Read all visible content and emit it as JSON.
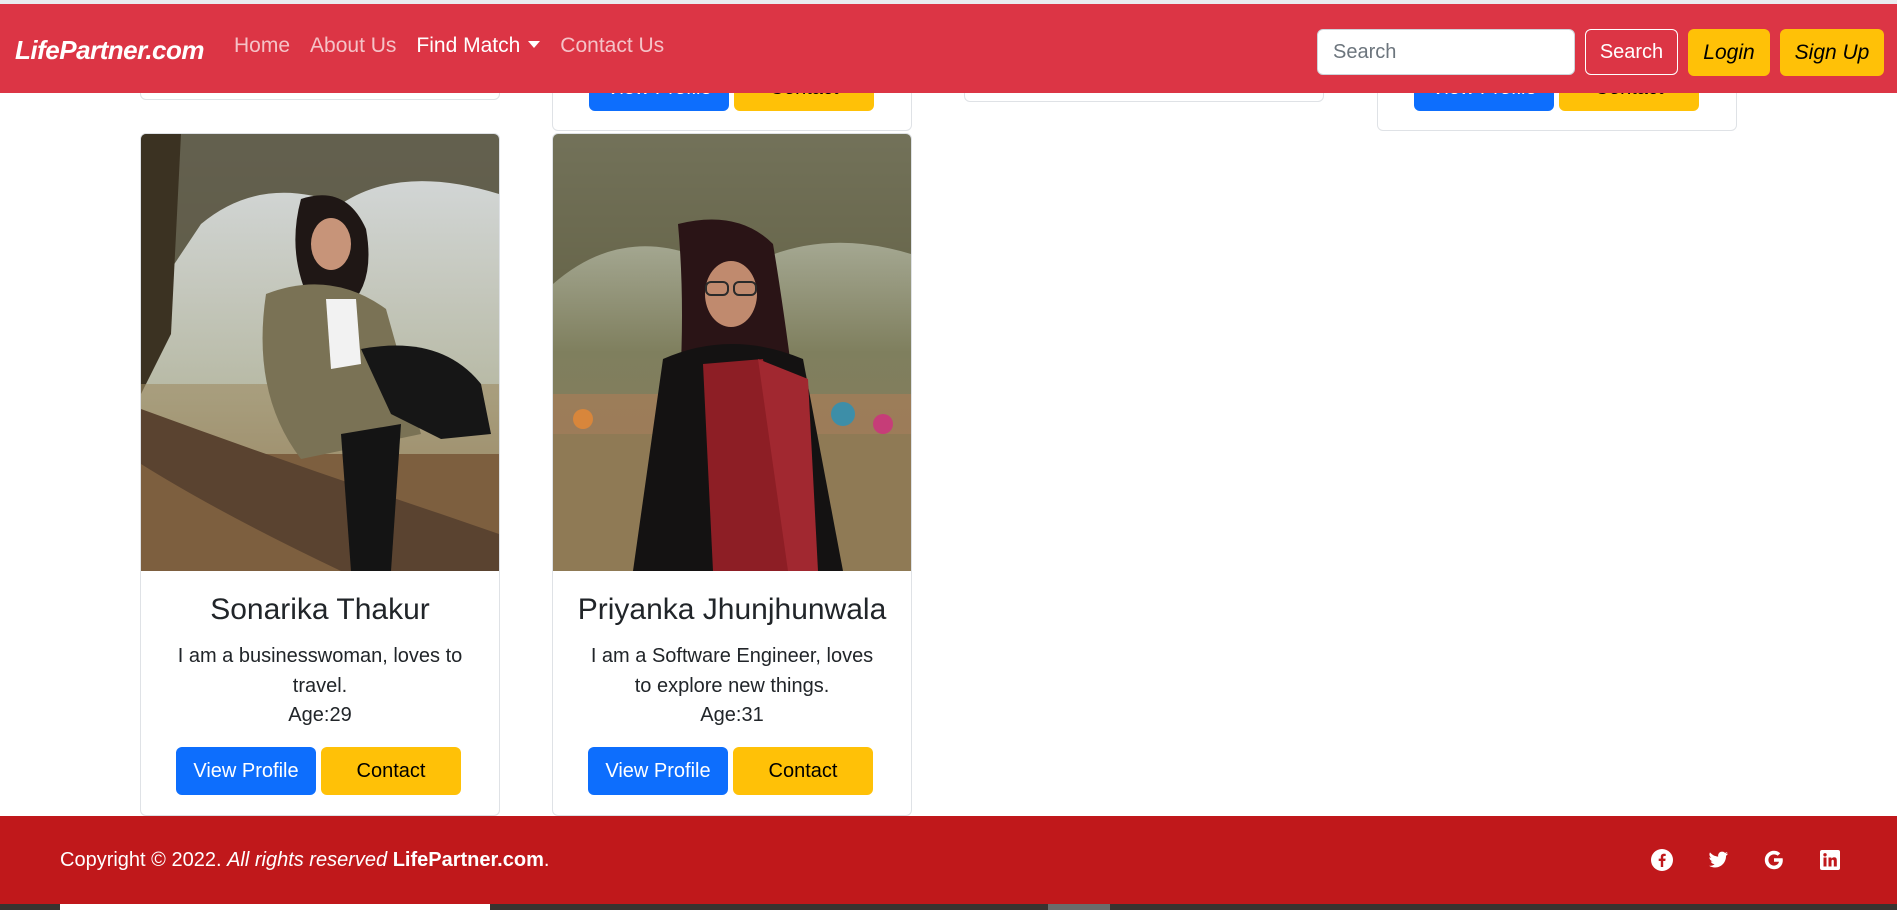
{
  "navbar": {
    "brand": "LifePartner.com",
    "links": [
      {
        "label": "Home"
      },
      {
        "label": "About Us"
      },
      {
        "label": "Find Match"
      },
      {
        "label": "Contact Us"
      }
    ],
    "search_placeholder": "Search",
    "search_button": "Search",
    "login_button": "Login",
    "signup_button": "Sign Up"
  },
  "partial_cards_top": [
    {
      "view_label": "View Profile",
      "contact_label": "Contact"
    },
    {
      "view_label": "View Profile",
      "contact_label": "Contact"
    }
  ],
  "profiles": [
    {
      "name": "Sonarika Thakur",
      "description": "I am a businesswoman, loves to travel.",
      "age": "Age:29",
      "view_label": "View Profile",
      "contact_label": "Contact"
    },
    {
      "name": "Priyanka Jhunjhunwala",
      "description": "I am a Software Engineer, loves to explore new things.",
      "age": "Age:31",
      "view_label": "View Profile",
      "contact_label": "Contact"
    }
  ],
  "footer": {
    "copyright_prefix": "Copyright © 2022.",
    "rights": "All rights reserved",
    "brand": "LifePartner.com",
    "suffix": ".",
    "social_icons": [
      "facebook-icon",
      "twitter-icon",
      "google-icon",
      "linkedin-icon"
    ]
  },
  "colors": {
    "navbar": "#dc3545",
    "footer": "#c0181b",
    "primary": "#0d6efd",
    "warning": "#ffc107"
  }
}
